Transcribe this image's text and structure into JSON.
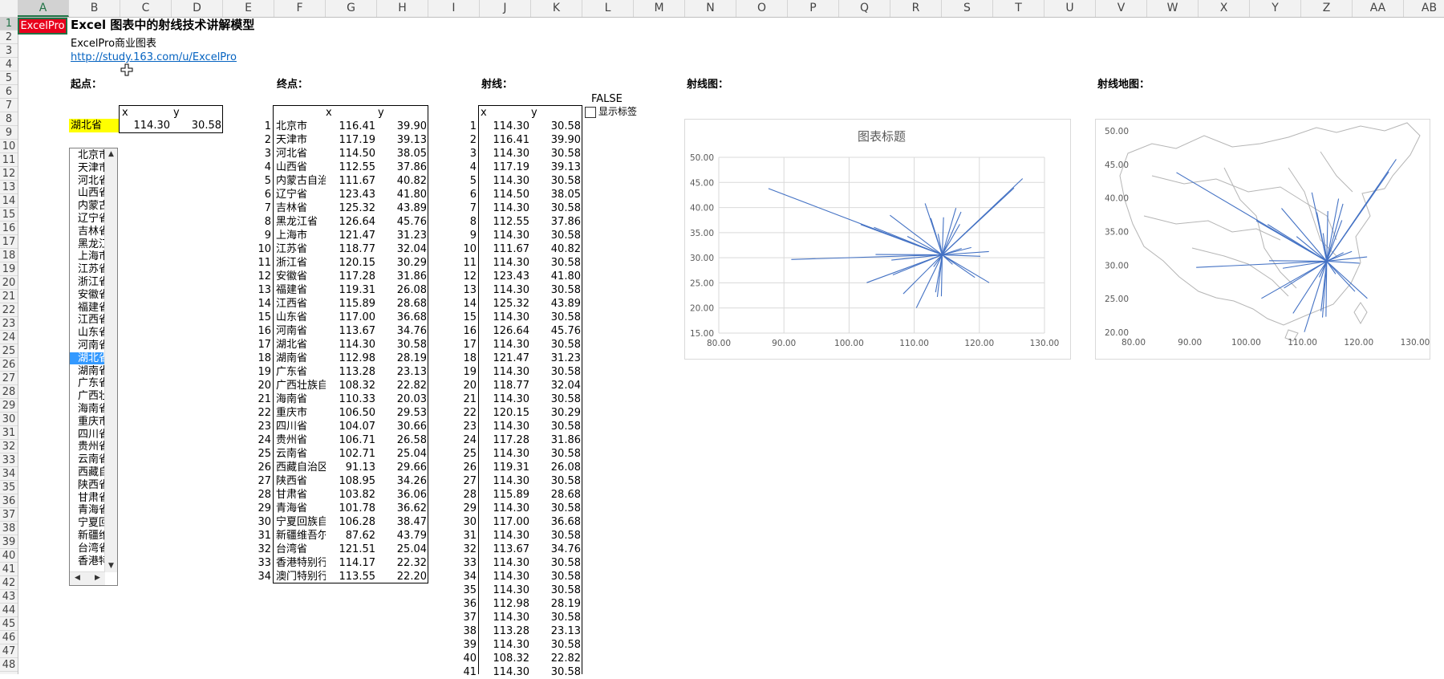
{
  "sheet": {
    "columns": [
      "A",
      "B",
      "C",
      "D",
      "E",
      "F",
      "G",
      "H",
      "I",
      "J",
      "K",
      "L",
      "M",
      "N",
      "O",
      "P",
      "Q",
      "R",
      "S",
      "T",
      "U",
      "V",
      "W",
      "X",
      "Y",
      "Z",
      "AA",
      "AB"
    ],
    "selected_column": "A",
    "rows": [
      1,
      2,
      3,
      4,
      5,
      6,
      7,
      8,
      9,
      10,
      11,
      12,
      13,
      14,
      15,
      16,
      17,
      18,
      19,
      20,
      21,
      22,
      23,
      24,
      25,
      26,
      27,
      28,
      29,
      30,
      31,
      32,
      33,
      34,
      35,
      36,
      37,
      38,
      39,
      40,
      41,
      42,
      43,
      44,
      45,
      46,
      47,
      48
    ],
    "selected_row": 1
  },
  "header": {
    "logo": "ExcelPro",
    "title": "Excel 图表中的射线技术讲解模型",
    "subtitle": "ExcelPro商业图表",
    "link": "http://study.163.com/u/ExcelPro"
  },
  "colors": {
    "accent_red": "#e8001c",
    "line_blue": "#4472c4",
    "highlight_yellow": "#ffff00",
    "select_blue": "#3399ff",
    "excel_green": "#217346"
  },
  "sections": {
    "start": "起点：",
    "end": "终点：",
    "rays": "射线：",
    "ray_chart": "射线图：",
    "ray_map": "射线地图："
  },
  "start_point": {
    "x_header": "x",
    "y_header": "y",
    "name": "湖北省",
    "x": "114.30",
    "y": "30.58"
  },
  "flag": {
    "value": "FALSE",
    "checkbox_label": "显示标签",
    "checked": false
  },
  "end_points": {
    "x_header": "x",
    "y_header": "y",
    "rows": [
      {
        "n": "1",
        "name": "北京市",
        "x": "116.41",
        "y": "39.90"
      },
      {
        "n": "2",
        "name": "天津市",
        "x": "117.19",
        "y": "39.13"
      },
      {
        "n": "3",
        "name": "河北省",
        "x": "114.50",
        "y": "38.05"
      },
      {
        "n": "4",
        "name": "山西省",
        "x": "112.55",
        "y": "37.86"
      },
      {
        "n": "5",
        "name": "内蒙古自治",
        "x": "111.67",
        "y": "40.82"
      },
      {
        "n": "6",
        "name": "辽宁省",
        "x": "123.43",
        "y": "41.80"
      },
      {
        "n": "7",
        "name": "吉林省",
        "x": "125.32",
        "y": "43.89"
      },
      {
        "n": "8",
        "name": "黑龙江省",
        "x": "126.64",
        "y": "45.76"
      },
      {
        "n": "9",
        "name": "上海市",
        "x": "121.47",
        "y": "31.23"
      },
      {
        "n": "10",
        "name": "江苏省",
        "x": "118.77",
        "y": "32.04"
      },
      {
        "n": "11",
        "name": "浙江省",
        "x": "120.15",
        "y": "30.29"
      },
      {
        "n": "12",
        "name": "安徽省",
        "x": "117.28",
        "y": "31.86"
      },
      {
        "n": "13",
        "name": "福建省",
        "x": "119.31",
        "y": "26.08"
      },
      {
        "n": "14",
        "name": "江西省",
        "x": "115.89",
        "y": "28.68"
      },
      {
        "n": "15",
        "name": "山东省",
        "x": "117.00",
        "y": "36.68"
      },
      {
        "n": "16",
        "name": "河南省",
        "x": "113.67",
        "y": "34.76"
      },
      {
        "n": "17",
        "name": "湖北省",
        "x": "114.30",
        "y": "30.58"
      },
      {
        "n": "18",
        "name": "湖南省",
        "x": "112.98",
        "y": "28.19"
      },
      {
        "n": "19",
        "name": "广东省",
        "x": "113.28",
        "y": "23.13"
      },
      {
        "n": "20",
        "name": "广西壮族自",
        "x": "108.32",
        "y": "22.82"
      },
      {
        "n": "21",
        "name": "海南省",
        "x": "110.33",
        "y": "20.03"
      },
      {
        "n": "22",
        "name": "重庆市",
        "x": "106.50",
        "y": "29.53"
      },
      {
        "n": "23",
        "name": "四川省",
        "x": "104.07",
        "y": "30.66"
      },
      {
        "n": "24",
        "name": "贵州省",
        "x": "106.71",
        "y": "26.58"
      },
      {
        "n": "25",
        "name": "云南省",
        "x": "102.71",
        "y": "25.04"
      },
      {
        "n": "26",
        "name": "西藏自治区",
        "x": "91.13",
        "y": "29.66"
      },
      {
        "n": "27",
        "name": "陕西省",
        "x": "108.95",
        "y": "34.26"
      },
      {
        "n": "28",
        "name": "甘肃省",
        "x": "103.82",
        "y": "36.06"
      },
      {
        "n": "29",
        "name": "青海省",
        "x": "101.78",
        "y": "36.62"
      },
      {
        "n": "30",
        "name": "宁夏回族自",
        "x": "106.28",
        "y": "38.47"
      },
      {
        "n": "31",
        "name": "新疆维吾尔",
        "x": "87.62",
        "y": "43.79"
      },
      {
        "n": "32",
        "name": "台湾省",
        "x": "121.51",
        "y": "25.04"
      },
      {
        "n": "33",
        "name": "香港特别行",
        "x": "114.17",
        "y": "22.32"
      },
      {
        "n": "34",
        "name": "澳门特别行",
        "x": "113.55",
        "y": "22.20"
      }
    ]
  },
  "rays": {
    "x_header": "x",
    "y_header": "y",
    "rows": [
      {
        "n": "1",
        "x": "114.30",
        "y": "30.58"
      },
      {
        "n": "2",
        "x": "116.41",
        "y": "39.90"
      },
      {
        "n": "3",
        "x": "114.30",
        "y": "30.58"
      },
      {
        "n": "4",
        "x": "117.19",
        "y": "39.13"
      },
      {
        "n": "5",
        "x": "114.30",
        "y": "30.58"
      },
      {
        "n": "6",
        "x": "114.50",
        "y": "38.05"
      },
      {
        "n": "7",
        "x": "114.30",
        "y": "30.58"
      },
      {
        "n": "8",
        "x": "112.55",
        "y": "37.86"
      },
      {
        "n": "9",
        "x": "114.30",
        "y": "30.58"
      },
      {
        "n": "10",
        "x": "111.67",
        "y": "40.82"
      },
      {
        "n": "11",
        "x": "114.30",
        "y": "30.58"
      },
      {
        "n": "12",
        "x": "123.43",
        "y": "41.80"
      },
      {
        "n": "13",
        "x": "114.30",
        "y": "30.58"
      },
      {
        "n": "14",
        "x": "125.32",
        "y": "43.89"
      },
      {
        "n": "15",
        "x": "114.30",
        "y": "30.58"
      },
      {
        "n": "16",
        "x": "126.64",
        "y": "45.76"
      },
      {
        "n": "17",
        "x": "114.30",
        "y": "30.58"
      },
      {
        "n": "18",
        "x": "121.47",
        "y": "31.23"
      },
      {
        "n": "19",
        "x": "114.30",
        "y": "30.58"
      },
      {
        "n": "20",
        "x": "118.77",
        "y": "32.04"
      },
      {
        "n": "21",
        "x": "114.30",
        "y": "30.58"
      },
      {
        "n": "22",
        "x": "120.15",
        "y": "30.29"
      },
      {
        "n": "23",
        "x": "114.30",
        "y": "30.58"
      },
      {
        "n": "24",
        "x": "117.28",
        "y": "31.86"
      },
      {
        "n": "25",
        "x": "114.30",
        "y": "30.58"
      },
      {
        "n": "26",
        "x": "119.31",
        "y": "26.08"
      },
      {
        "n": "27",
        "x": "114.30",
        "y": "30.58"
      },
      {
        "n": "28",
        "x": "115.89",
        "y": "28.68"
      },
      {
        "n": "29",
        "x": "114.30",
        "y": "30.58"
      },
      {
        "n": "30",
        "x": "117.00",
        "y": "36.68"
      },
      {
        "n": "31",
        "x": "114.30",
        "y": "30.58"
      },
      {
        "n": "32",
        "x": "113.67",
        "y": "34.76"
      },
      {
        "n": "33",
        "x": "114.30",
        "y": "30.58"
      },
      {
        "n": "34",
        "x": "114.30",
        "y": "30.58"
      },
      {
        "n": "35",
        "x": "114.30",
        "y": "30.58"
      },
      {
        "n": "36",
        "x": "112.98",
        "y": "28.19"
      },
      {
        "n": "37",
        "x": "114.30",
        "y": "30.58"
      },
      {
        "n": "38",
        "x": "113.28",
        "y": "23.13"
      },
      {
        "n": "39",
        "x": "114.30",
        "y": "30.58"
      },
      {
        "n": "40",
        "x": "108.32",
        "y": "22.82"
      },
      {
        "n": "41",
        "x": "114.30",
        "y": "30.58"
      }
    ]
  },
  "listbox": {
    "items": [
      "北京市",
      "天津市",
      "河北省",
      "山西省",
      "内蒙古",
      "辽宁省",
      "吉林省",
      "黑龙江",
      "上海市",
      "江苏省",
      "浙江省",
      "安徽省",
      "福建省",
      "江西省",
      "山东省",
      "河南省",
      "湖北省",
      "湖南省",
      "广东省",
      "广西壮",
      "海南省",
      "重庆市",
      "四川省",
      "贵州省",
      "云南省",
      "西藏自",
      "陕西省",
      "甘肃省",
      "青海省",
      "宁夏回",
      "新疆维",
      "台湾省",
      "香港特"
    ],
    "selected_index": 16
  },
  "chart_data": [
    {
      "type": "line",
      "title": "图表标题",
      "xlim": [
        80,
        130
      ],
      "ylim": [
        15,
        50
      ],
      "x_ticks": [
        "80.00",
        "90.00",
        "100.00",
        "110.00",
        "120.00",
        "130.00"
      ],
      "y_ticks": [
        "15.00",
        "20.00",
        "25.00",
        "30.00",
        "35.00",
        "40.00",
        "45.00",
        "50.00"
      ],
      "grid": true,
      "origin": {
        "x": 114.3,
        "y": 30.58
      },
      "targets": [
        [
          116.41,
          39.9
        ],
        [
          117.19,
          39.13
        ],
        [
          114.5,
          38.05
        ],
        [
          112.55,
          37.86
        ],
        [
          111.67,
          40.82
        ],
        [
          123.43,
          41.8
        ],
        [
          125.32,
          43.89
        ],
        [
          126.64,
          45.76
        ],
        [
          121.47,
          31.23
        ],
        [
          118.77,
          32.04
        ],
        [
          120.15,
          30.29
        ],
        [
          117.28,
          31.86
        ],
        [
          119.31,
          26.08
        ],
        [
          115.89,
          28.68
        ],
        [
          117.0,
          36.68
        ],
        [
          113.67,
          34.76
        ],
        [
          114.3,
          30.58
        ],
        [
          112.98,
          28.19
        ],
        [
          113.28,
          23.13
        ],
        [
          108.32,
          22.82
        ],
        [
          110.33,
          20.03
        ],
        [
          106.5,
          29.53
        ],
        [
          104.07,
          30.66
        ],
        [
          106.71,
          26.58
        ],
        [
          102.71,
          25.04
        ],
        [
          91.13,
          29.66
        ],
        [
          108.95,
          34.26
        ],
        [
          103.82,
          36.06
        ],
        [
          101.78,
          36.62
        ],
        [
          106.28,
          38.47
        ],
        [
          87.62,
          43.79
        ],
        [
          121.51,
          25.04
        ],
        [
          114.17,
          22.32
        ],
        [
          113.55,
          22.2
        ]
      ]
    },
    {
      "type": "line",
      "title": "",
      "xlim": [
        80,
        130
      ],
      "ylim": [
        20,
        50
      ],
      "x_ticks": [
        "80.00",
        "90.00",
        "100.00",
        "110.00",
        "120.00",
        "130.00"
      ],
      "y_ticks": [
        "20.00",
        "25.00",
        "30.00",
        "35.00",
        "40.00",
        "45.00",
        "50.00"
      ],
      "grid": false,
      "background": "map-outline",
      "origin": {
        "x": 114.3,
        "y": 30.58
      },
      "targets": [
        [
          116.41,
          39.9
        ],
        [
          117.19,
          39.13
        ],
        [
          114.5,
          38.05
        ],
        [
          112.55,
          37.86
        ],
        [
          111.67,
          40.82
        ],
        [
          123.43,
          41.8
        ],
        [
          125.32,
          43.89
        ],
        [
          126.64,
          45.76
        ],
        [
          121.47,
          31.23
        ],
        [
          118.77,
          32.04
        ],
        [
          120.15,
          30.29
        ],
        [
          117.28,
          31.86
        ],
        [
          119.31,
          26.08
        ],
        [
          115.89,
          28.68
        ],
        [
          117.0,
          36.68
        ],
        [
          113.67,
          34.76
        ],
        [
          114.3,
          30.58
        ],
        [
          112.98,
          28.19
        ],
        [
          113.28,
          23.13
        ],
        [
          108.32,
          22.82
        ],
        [
          110.33,
          20.03
        ],
        [
          106.5,
          29.53
        ],
        [
          104.07,
          30.66
        ],
        [
          106.71,
          26.58
        ],
        [
          102.71,
          25.04
        ],
        [
          91.13,
          29.66
        ],
        [
          108.95,
          34.26
        ],
        [
          103.82,
          36.06
        ],
        [
          101.78,
          36.62
        ],
        [
          106.28,
          38.47
        ],
        [
          87.62,
          43.79
        ],
        [
          121.51,
          25.04
        ],
        [
          114.17,
          22.32
        ],
        [
          113.55,
          22.2
        ]
      ]
    }
  ]
}
